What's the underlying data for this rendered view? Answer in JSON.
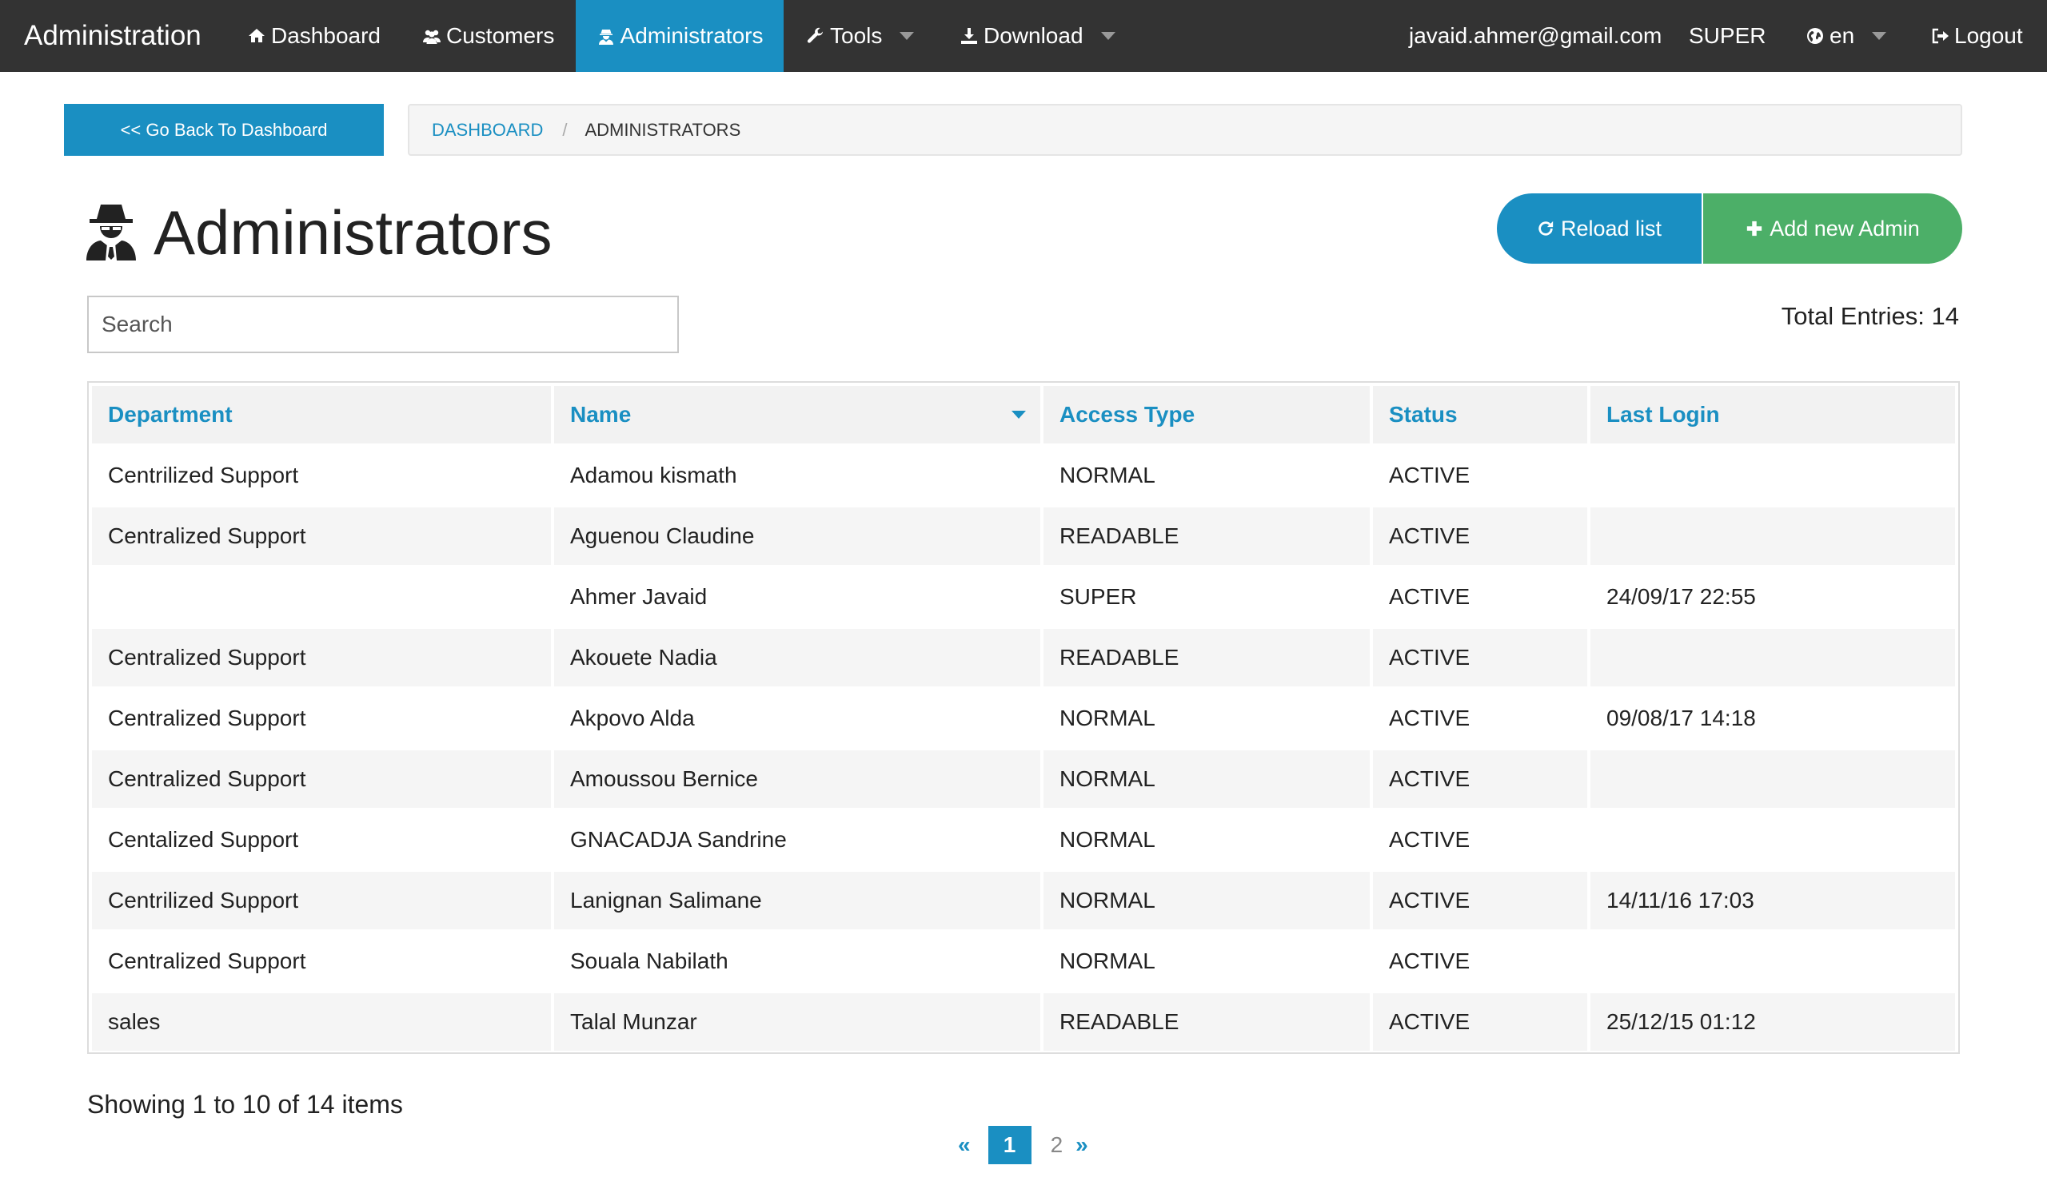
{
  "navbar": {
    "brand": "Administration",
    "items": [
      {
        "label": "Dashboard"
      },
      {
        "label": "Customers"
      },
      {
        "label": "Administrators",
        "active": true
      },
      {
        "label": "Tools"
      },
      {
        "label": "Download"
      }
    ],
    "user_email": "javaid.ahmer@gmail.com",
    "role": "SUPER",
    "language": "en",
    "logout_label": "Logout"
  },
  "back_button": {
    "label": "<< Go Back To Dashboard"
  },
  "breadcrumb": {
    "link": "DASHBOARD",
    "separator": "/",
    "current": "ADMINISTRATORS"
  },
  "page": {
    "title": "Administrators"
  },
  "actions": {
    "reload_label": "Reload list",
    "add_label": "Add new Admin"
  },
  "search": {
    "placeholder": "Search",
    "value": ""
  },
  "total_entries": "Total Entries: 14",
  "table": {
    "columns": [
      "Department",
      "Name",
      "Access Type",
      "Status",
      "Last Login"
    ],
    "rows": [
      [
        "Centrilized Support",
        "Adamou kismath",
        "NORMAL",
        "ACTIVE",
        ""
      ],
      [
        "Centralized Support",
        "Aguenou Claudine",
        "READABLE",
        "ACTIVE",
        ""
      ],
      [
        "",
        "Ahmer Javaid",
        "SUPER",
        "ACTIVE",
        "24/09/17 22:55"
      ],
      [
        "Centralized Support",
        "Akouete Nadia",
        "READABLE",
        "ACTIVE",
        ""
      ],
      [
        "Centralized Support",
        "Akpovo Alda",
        "NORMAL",
        "ACTIVE",
        "09/08/17 14:18"
      ],
      [
        "Centralized Support",
        "Amoussou Bernice",
        "NORMAL",
        "ACTIVE",
        ""
      ],
      [
        "Centalized Support",
        "GNACADJA Sandrine",
        "NORMAL",
        "ACTIVE",
        ""
      ],
      [
        "Centrilized Support",
        "Lanignan Salimane",
        "NORMAL",
        "ACTIVE",
        "14/11/16 17:03"
      ],
      [
        "Centralized Support",
        "Souala Nabilath",
        "NORMAL",
        "ACTIVE",
        ""
      ],
      [
        "sales",
        "Talal Munzar",
        "READABLE",
        "ACTIVE",
        "25/12/15 01:12"
      ]
    ]
  },
  "footer": {
    "showing": "Showing 1 to 10 of 14 items"
  },
  "pagination": {
    "prev": "«",
    "pages": [
      "1",
      "2"
    ],
    "current": "1",
    "next": "»"
  },
  "colors": {
    "primary": "#1a8fc2",
    "success": "#4caf68",
    "navbar": "#333333"
  },
  "icons": {
    "nav": [
      "home-icon",
      "users-icon",
      "user-secret-icon",
      "wrench-icon",
      "download-icon",
      "globe-icon",
      "logout-icon"
    ],
    "title": "user-secret-icon",
    "reload": "refresh-icon",
    "add": "plus-icon"
  }
}
